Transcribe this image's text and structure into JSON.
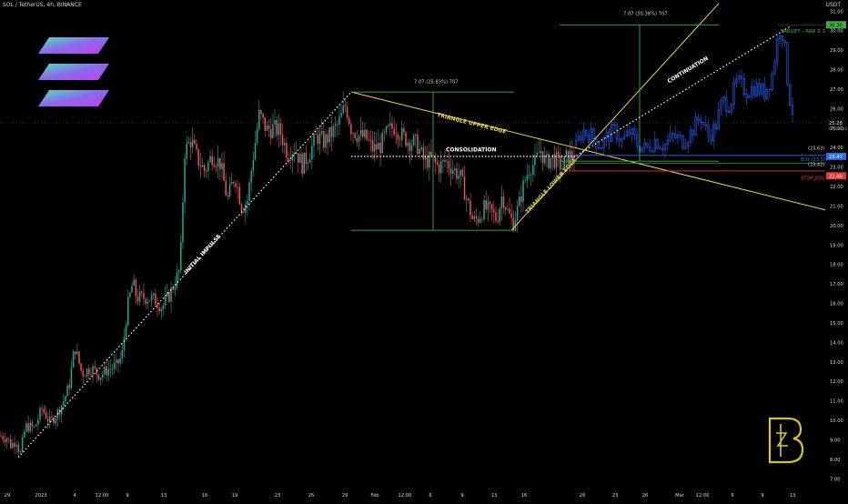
{
  "header": {
    "symbol_line": "SOL / TetherUS, 4h, BINANCE",
    "currency": "USDT"
  },
  "colors": {
    "background": "#000000",
    "candle_up": "#26a69a",
    "candle_down": "#ef5350",
    "line_yellow": "#e8d44d",
    "box_green": "#3fae49",
    "stop_red": "#e53935",
    "entry_blue": "#2f6fe0",
    "projection_blue": "#2962ff",
    "text": "#d1d4dc",
    "dotted": "#ffffff",
    "logo_gold": "#d4c62a"
  },
  "annotations": {
    "initial_impulse": "INITIAL IMPULSE",
    "triangle_upper": "TRIANGLE UPPER EDGE",
    "triangle_lower": "TRIANGLE LOWER EDGE",
    "consolidation": "CONSOLIDATION",
    "continuation": "CONTINUATION",
    "measure_1": "7.07 (25.83%) 707",
    "measure_2": "7.07 (30.38%) 707",
    "target": "TARGET - RRR 9.3",
    "buy": "BUY (23.50)",
    "stoploss": "STOPLOSS",
    "level_23_63": "(23.63)",
    "level_23_42": "(23.42)"
  },
  "price_badges": {
    "target": "30.30",
    "current": "25.28",
    "current_sub": "01:14:16",
    "entry": "23.47",
    "stop": "22.40"
  },
  "chart_data": {
    "type": "candlestick",
    "y_axis": {
      "range": [
        6.5,
        31.2
      ],
      "ticks": [
        "7.00",
        "8.00",
        "9.00",
        "10.00",
        "11.00",
        "12.00",
        "13.00",
        "14.00",
        "15.00",
        "16.00",
        "17.00",
        "18.00",
        "19.00",
        "20.00",
        "21.00",
        "22.00",
        "23.00",
        "24.00",
        "25.00",
        "26.00",
        "27.00",
        "28.00",
        "29.00",
        "30.00",
        "31.00"
      ]
    },
    "x_axis": {
      "ticks": [
        "29",
        "2023",
        "4",
        "12:00",
        "9",
        "13",
        "16",
        "19",
        "23",
        "26",
        "29",
        "Feb",
        "12:00",
        "6",
        "9",
        "13",
        "16",
        "20",
        "23",
        "26",
        "Mar",
        "12:00",
        "6",
        "9",
        "13"
      ]
    },
    "key_points": [
      {
        "label": "impulse start",
        "price": 8.1
      },
      {
        "label": "impulse end",
        "price": 26.85
      },
      {
        "label": "consolidation low",
        "price": 19.75
      },
      {
        "label": "entry",
        "price": 23.5
      },
      {
        "label": "stop",
        "price": 22.4
      },
      {
        "label": "target",
        "price": 30.3
      }
    ],
    "legend": "none",
    "grid": false
  }
}
